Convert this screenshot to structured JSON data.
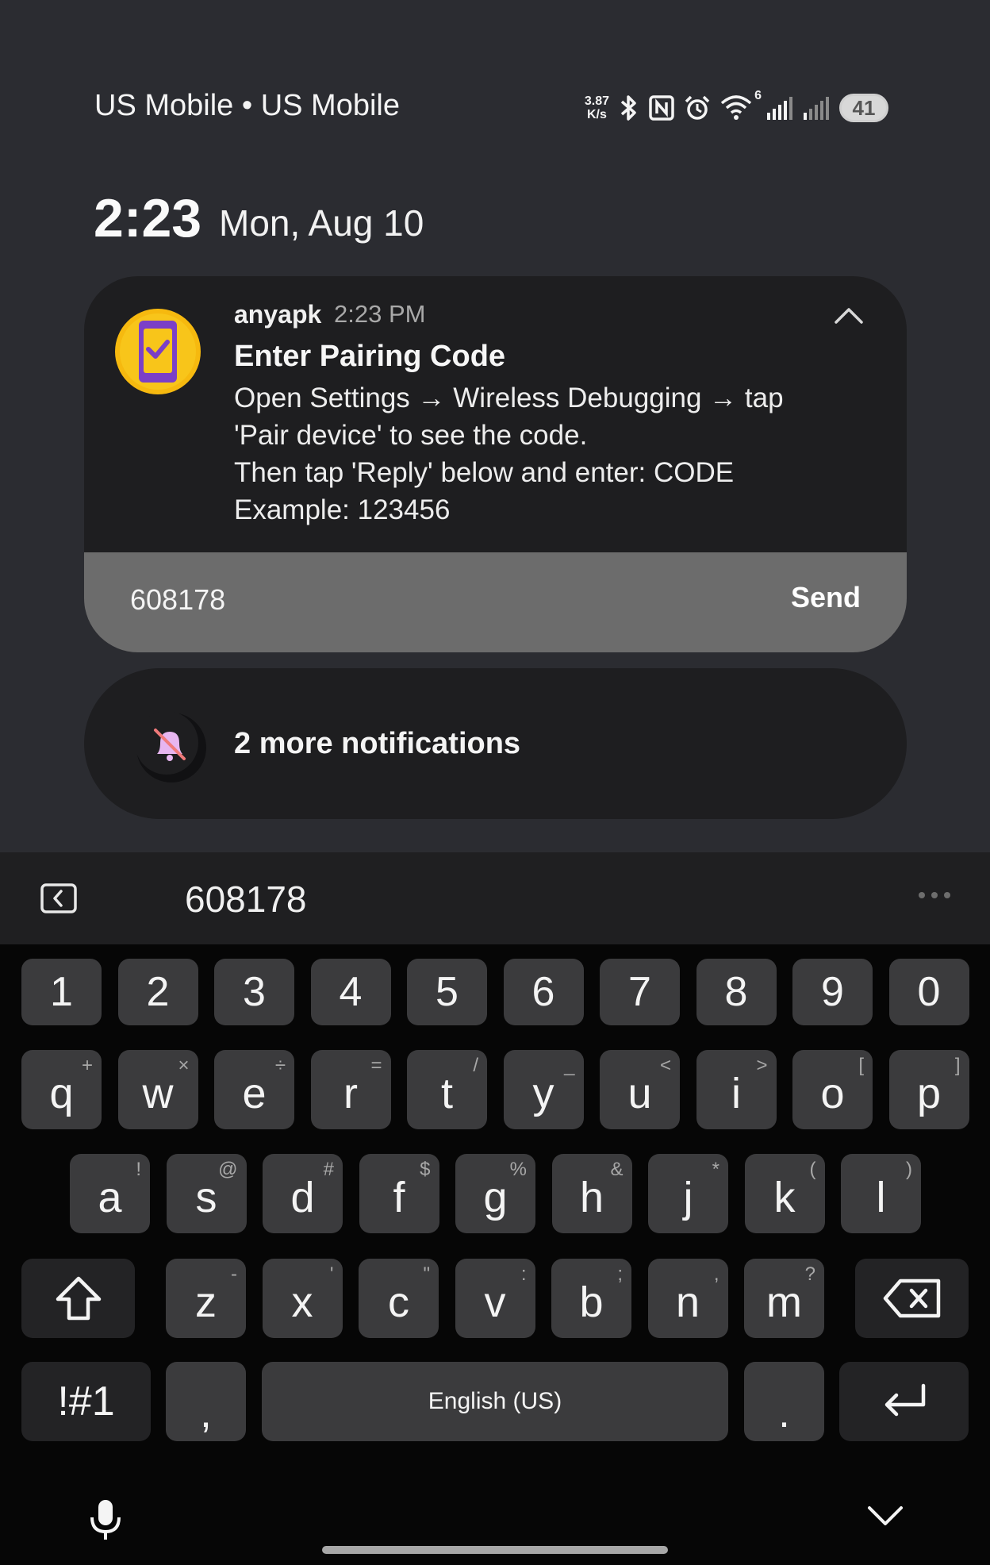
{
  "status_bar": {
    "carrier": "US Mobile • US Mobile",
    "net_speed_value": "3.87",
    "net_speed_unit": "K/s",
    "wifi_badge": "6",
    "battery": "41",
    "icons": [
      "bluetooth-icon",
      "nfc-icon",
      "alarm-icon",
      "wifi-icon",
      "signal-icon",
      "signal-icon",
      "battery-icon"
    ]
  },
  "clock": {
    "time": "2:23",
    "date": "Mon, Aug 10"
  },
  "notification": {
    "app_name": "anyapk",
    "time": "2:23 PM",
    "title": "Enter Pairing Code",
    "body_lines": [
      "Open Settings → Wireless Debugging → tap",
      "'Pair device' to see the code.",
      "Then tap 'Reply' below and enter: CODE",
      "Example: 123456"
    ],
    "reply_value": "608178",
    "send_label": "Send",
    "accent_color": "#f5b800"
  },
  "more_notifications": {
    "label": "2 more notifications"
  },
  "keyboard": {
    "suggestion": "608178",
    "number_row": [
      "1",
      "2",
      "3",
      "4",
      "5",
      "6",
      "7",
      "8",
      "9",
      "0"
    ],
    "row1": [
      {
        "k": "q",
        "h": "+"
      },
      {
        "k": "w",
        "h": "×"
      },
      {
        "k": "e",
        "h": "÷"
      },
      {
        "k": "r",
        "h": "="
      },
      {
        "k": "t",
        "h": "/"
      },
      {
        "k": "y",
        "h": "_"
      },
      {
        "k": "u",
        "h": "<"
      },
      {
        "k": "i",
        "h": ">"
      },
      {
        "k": "o",
        "h": "["
      },
      {
        "k": "p",
        "h": "]"
      }
    ],
    "row2": [
      {
        "k": "a",
        "h": "!"
      },
      {
        "k": "s",
        "h": "@"
      },
      {
        "k": "d",
        "h": "#"
      },
      {
        "k": "f",
        "h": "$"
      },
      {
        "k": "g",
        "h": "%"
      },
      {
        "k": "h",
        "h": "&"
      },
      {
        "k": "j",
        "h": "*"
      },
      {
        "k": "k",
        "h": "("
      },
      {
        "k": "l",
        "h": ")"
      }
    ],
    "row3": [
      {
        "k": "z",
        "h": "-"
      },
      {
        "k": "x",
        "h": "'"
      },
      {
        "k": "c",
        "h": "\""
      },
      {
        "k": "v",
        "h": ":"
      },
      {
        "k": "b",
        "h": ";"
      },
      {
        "k": "n",
        "h": ","
      },
      {
        "k": "m",
        "h": "?"
      }
    ],
    "symbols_label": "!#1",
    "comma": ",",
    "space_label": "English (US)",
    "period": "."
  }
}
